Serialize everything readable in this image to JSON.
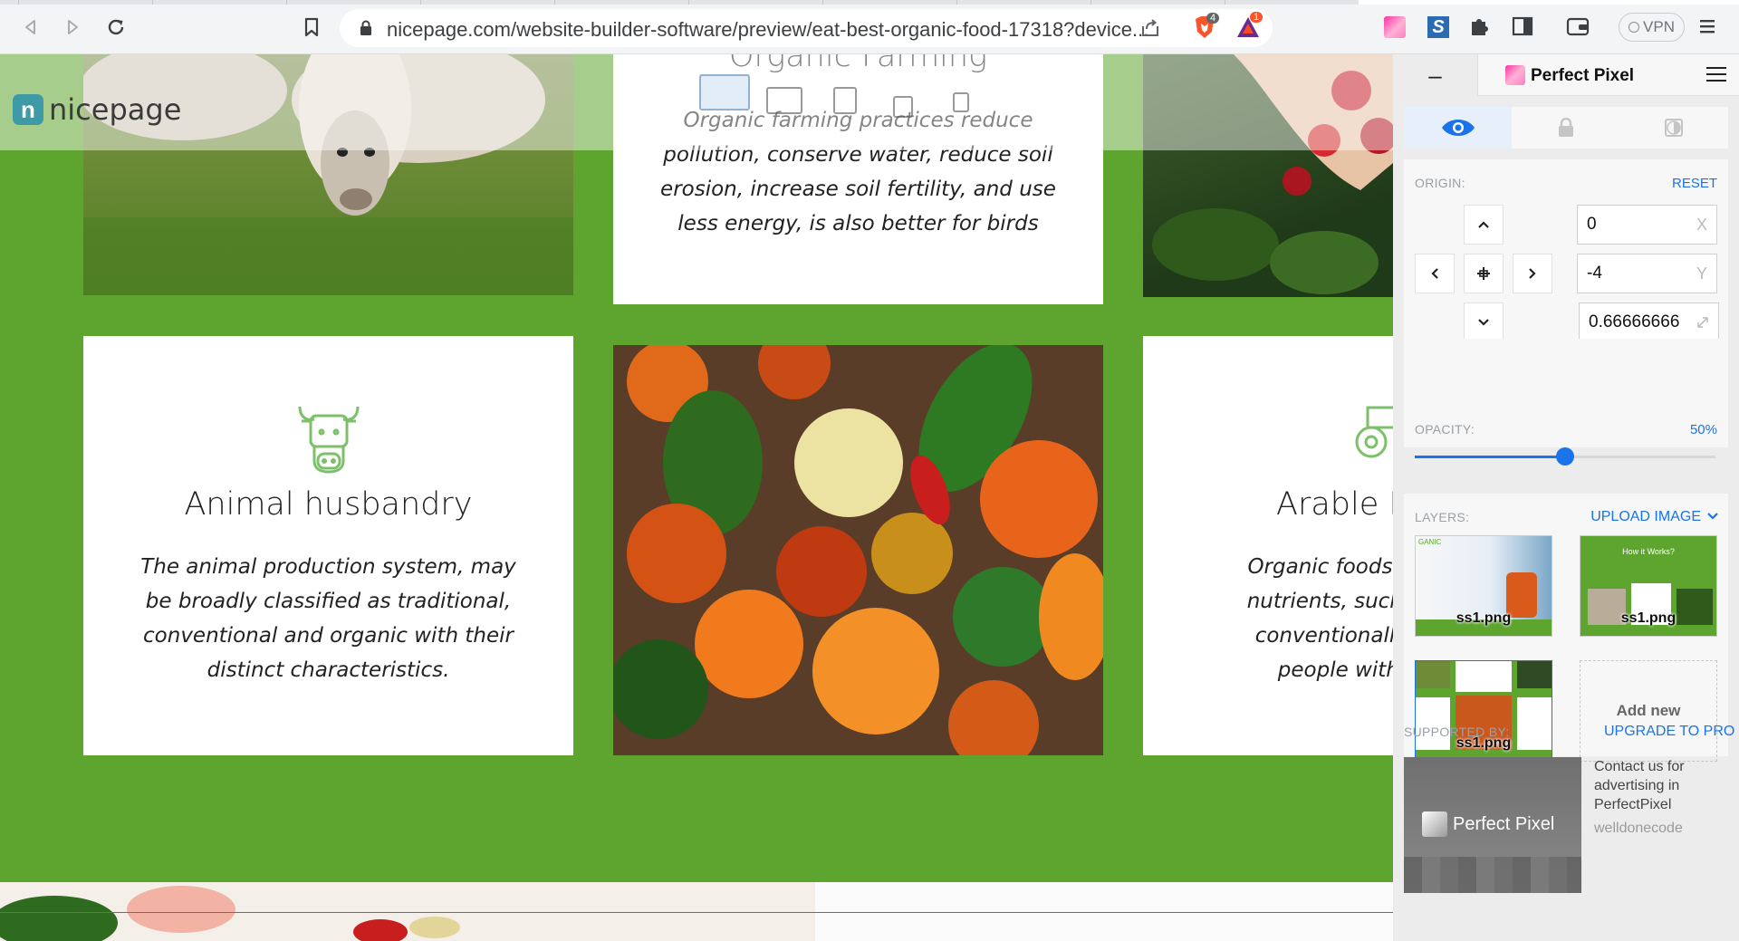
{
  "browser": {
    "url": "nicepage.com/website-builder-software/preview/eat-best-organic-food-17318?device...",
    "vpn_label": "VPN",
    "brave_badge": "4",
    "rewards_badge": "1"
  },
  "site": {
    "logo_text": "nicepage",
    "cards": [
      {
        "title": "Organic Farming",
        "text": "Organic farming practices reduce pollution, conserve water, reduce soil erosion, increase soil fertility, and use less energy, is also better for birds"
      },
      {
        "title": "Animal husbandry",
        "text": "The animal production system, may be broadly classified as traditional, conventional and organic with their distinct characteristics."
      },
      {
        "title": "Arable F",
        "text": "Organic foods often h\nnutrients, such as ant\nconventionally-grow\npeople with alle"
      }
    ]
  },
  "panel": {
    "title": "Perfect Pixel",
    "minimize_label": "–",
    "origin_label": "ORIGIN:",
    "reset_label": "RESET",
    "x_value": "0",
    "x_suffix": "X",
    "y_value": "-4",
    "y_suffix": "Y",
    "scale_value": "0.66666666",
    "opacity_label": "OPACITY:",
    "opacity_value": "50%",
    "opacity_fraction": 0.5,
    "layers_label": "LAYERS:",
    "upload_label": "UPLOAD IMAGE",
    "layers": [
      {
        "name": "ss1.png",
        "tag": "GANIC"
      },
      {
        "name": "ss1.png",
        "tag": "How it Works?"
      },
      {
        "name": "ss1.png"
      }
    ],
    "add_new_label": "Add new",
    "supported_label": "SUPPORTED BY:",
    "upgrade_label": "UPGRADE TO PRO",
    "ad_brand": "Perfect Pixel",
    "ad_text": "Contact us for advertising in PerfectPixel",
    "ad_link": "welldonecode"
  }
}
